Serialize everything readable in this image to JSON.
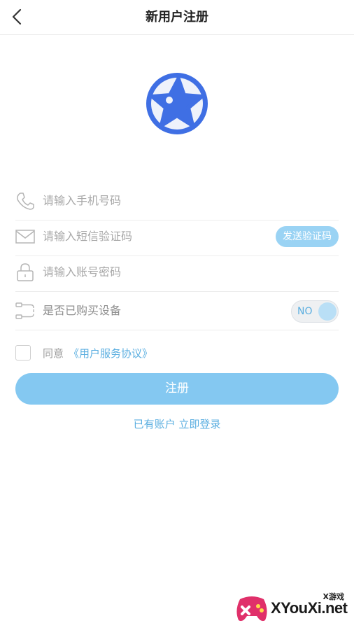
{
  "header": {
    "title": "新用户注册"
  },
  "form": {
    "phone_placeholder": "请输入手机号码",
    "code_placeholder": "请输入短信验证码",
    "send_code_label": "发送验证码",
    "password_placeholder": "请输入账号密码",
    "device_label": "是否已购买设备",
    "device_toggle_text": "NO"
  },
  "agreement": {
    "prefix": "同意",
    "link": "《用户服务协议》"
  },
  "actions": {
    "register_label": "注册",
    "login_link": "已有账户 立即登录"
  },
  "watermark": {
    "text": "XYouXi.net",
    "small": "X游戏"
  },
  "colors": {
    "accent": "#84c8f1",
    "link": "#5aaee0",
    "logo": "#3f6fe4"
  },
  "icons": [
    "back-arrow-icon",
    "app-logo-icon",
    "phone-icon",
    "mail-icon",
    "lock-icon",
    "device-icon"
  ]
}
